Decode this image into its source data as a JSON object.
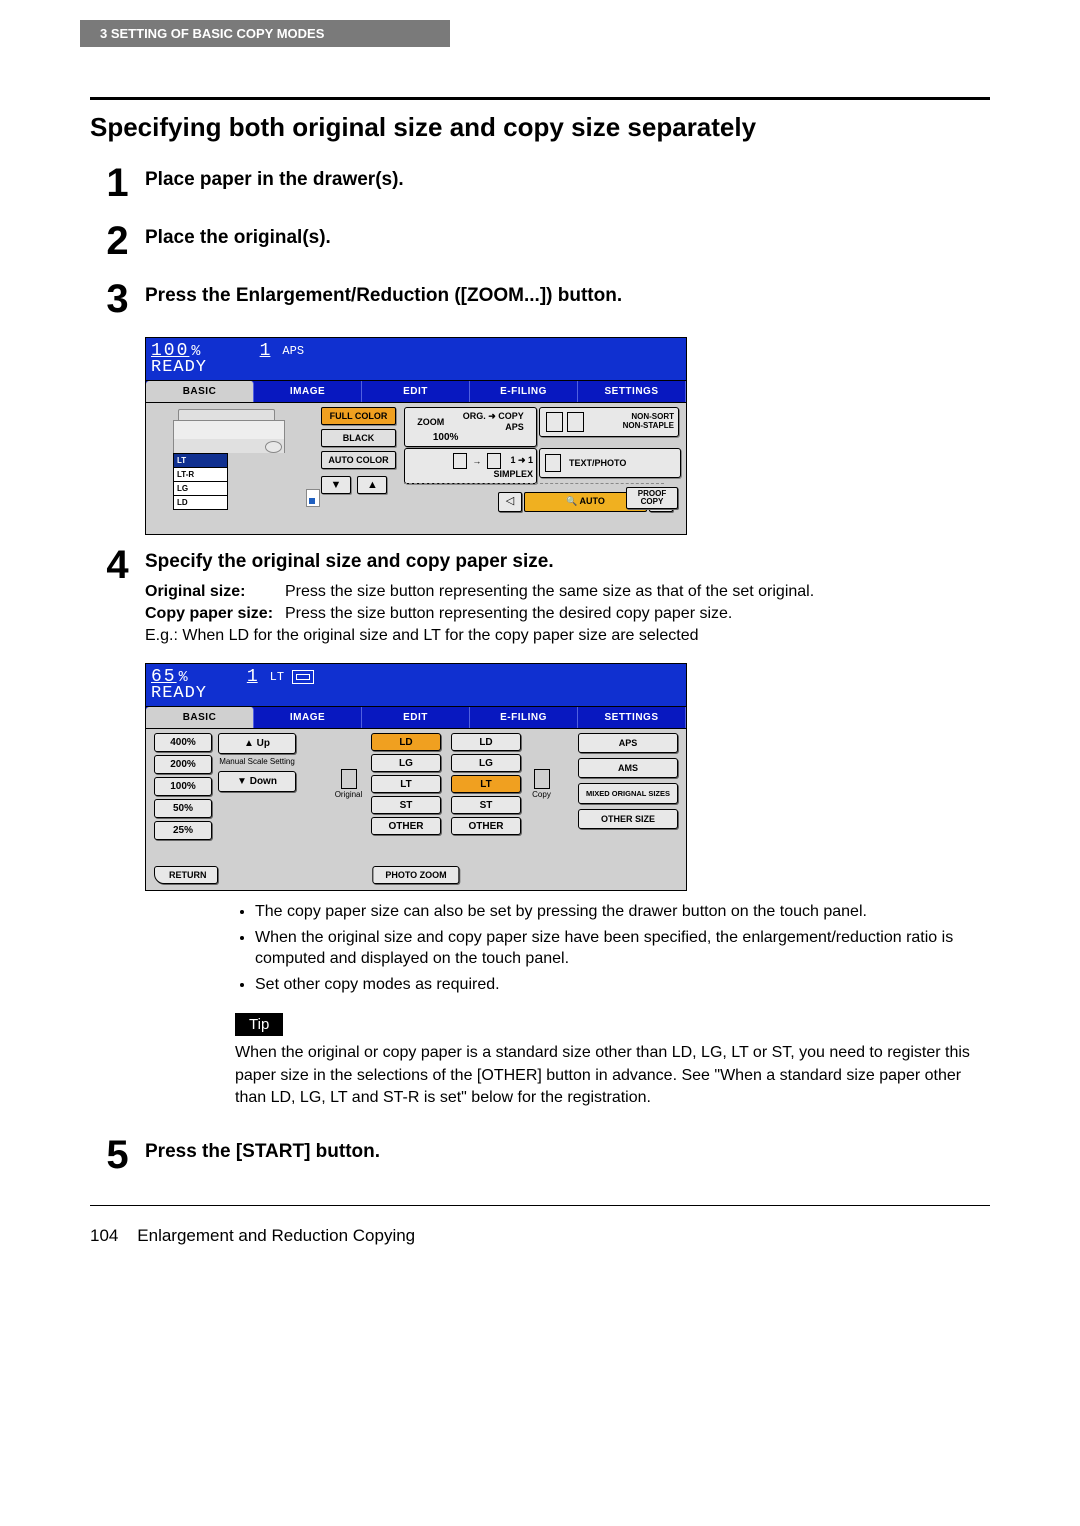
{
  "header": "3   SETTING OF BASIC COPY MODES",
  "title": "Specifying both original size and copy size separately",
  "steps": {
    "s1": {
      "num": "1",
      "title": "Place paper in the drawer(s)."
    },
    "s2": {
      "num": "2",
      "title": "Place the original(s)."
    },
    "s3": {
      "num": "3",
      "title": "Press the Enlargement/Reduction ([ZOOM...]) button."
    },
    "s4": {
      "num": "4",
      "title": "Specify the original size and copy paper size."
    },
    "s5": {
      "num": "5",
      "title": "Press the [START] button."
    }
  },
  "panel1": {
    "percent": "100",
    "pct_sym": "%",
    "copies": "1",
    "size_ind": "APS",
    "ready": "READY",
    "tabs": [
      "BASIC",
      "IMAGE",
      "EDIT",
      "E-FILING",
      "SETTINGS"
    ],
    "drawers": [
      "LT",
      "LT-R",
      "LG",
      "LD"
    ],
    "color": {
      "full": "FULL COLOR",
      "black": "BLACK",
      "auto": "AUTO COLOR"
    },
    "arrows": {
      "down": "▼",
      "up": "▲"
    },
    "zoom": {
      "l": "ZOOM",
      "v": "100%",
      "r": "ORG. ➜ COPY",
      "r2": "APS"
    },
    "simplex": {
      "txt": "1 ➜ 1",
      "lbl": "SIMPLEX"
    },
    "sort": {
      "l1": "NON-SORT",
      "l2": "NON-STAPLE"
    },
    "textphoto": "TEXT/PHOTO",
    "dens": {
      "left": "◁",
      "mid": "🔍 AUTO",
      "right": "▷"
    },
    "proof": {
      "l1": "PROOF",
      "l2": "COPY"
    }
  },
  "panel2": {
    "percent": "65",
    "pct_sym": "%",
    "copies": "1",
    "size_ind": "LT",
    "ready": "READY",
    "tabs": [
      "BASIC",
      "IMAGE",
      "EDIT",
      "E-FILING",
      "SETTINGS"
    ],
    "ratios": [
      "400%",
      "200%",
      "100%",
      "50%",
      "25%"
    ],
    "up": "▲ Up",
    "down": "▼ Down",
    "manual": "Manual Scale Setting",
    "orig_lbl": "Original",
    "copy_lbl": "Copy",
    "orig_sizes": [
      "LD",
      "LG",
      "LT",
      "ST",
      "OTHER"
    ],
    "copy_sizes": [
      "LD",
      "LG",
      "LT",
      "ST",
      "OTHER"
    ],
    "orig_sel": "LD",
    "copy_sel": "LT",
    "modes": [
      "APS",
      "AMS",
      "MIXED ORIGNAL SIZES",
      "OTHER SIZE"
    ],
    "return": "RETURN",
    "photozoom": "PHOTO ZOOM"
  },
  "defs": {
    "orig_lbl": "Original size:",
    "orig_txt": "Press the size button representing the same size as that of the set original.",
    "copy_lbl": "Copy paper size:",
    "copy_txt": "Press the size button representing the desired copy paper size.",
    "eg": "E.g.: When LD for the original size and LT for the copy paper size are selected"
  },
  "bullets": [
    "The copy paper size can also be set by pressing the drawer button on the touch panel.",
    "When the original size and copy paper size have been specified, the enlargement/reduction ratio is computed and displayed on the touch panel.",
    "Set other copy modes as required."
  ],
  "tip": {
    "label": "Tip",
    "text": "When the original or copy paper is a standard size other than LD, LG, LT or ST, you need to register this paper size in the selections of the [OTHER] button in advance. See \"When a standard size paper other than LD, LG, LT and ST-R is set\" below for the registration."
  },
  "footer": {
    "page": "104",
    "section": "Enlargement and Reduction Copying"
  }
}
